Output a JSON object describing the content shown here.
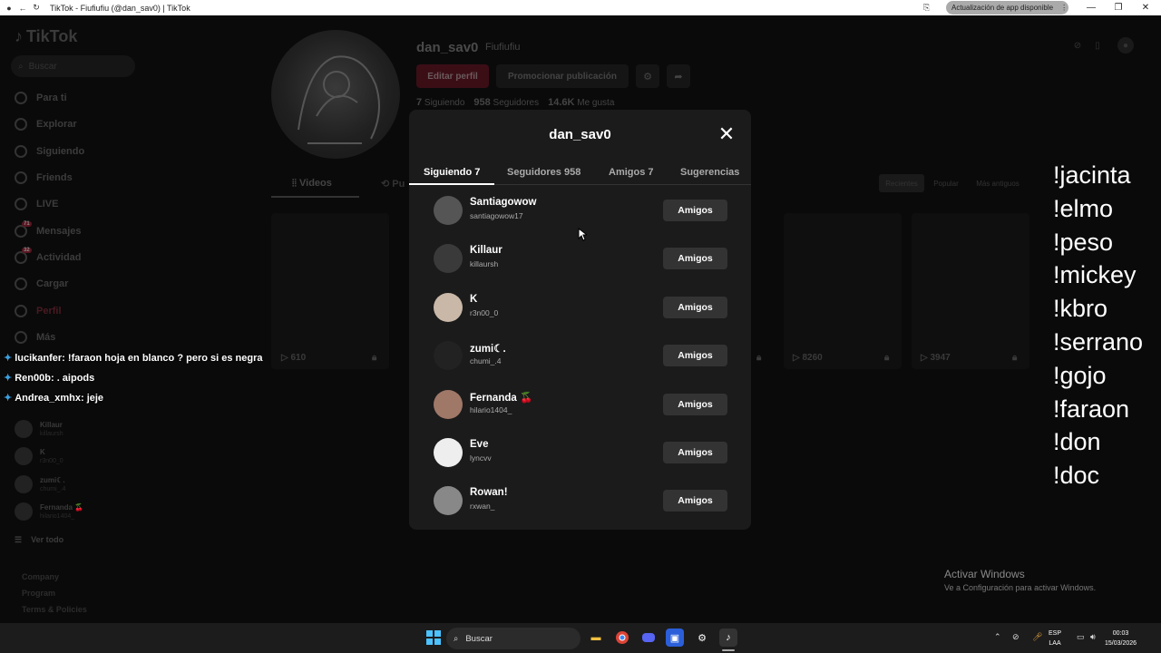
{
  "browser": {
    "title": "TikTok - Fiufiufiu (@dan_sav0) | TikTok",
    "update_pill": "Actualización de app disponible"
  },
  "sidebar": {
    "logo": "TikTok",
    "search_placeholder": "Buscar",
    "nav": [
      {
        "label": "Para ti",
        "icon": "home-icon"
      },
      {
        "label": "Explorar",
        "icon": "compass-icon"
      },
      {
        "label": "Siguiendo",
        "icon": "following-icon"
      },
      {
        "label": "Friends",
        "icon": "friends-icon"
      },
      {
        "label": "LIVE",
        "icon": "live-icon"
      },
      {
        "label": "Mensajes",
        "icon": "messages-icon",
        "badge": "71"
      },
      {
        "label": "Actividad",
        "icon": "activity-icon",
        "badge": "32"
      },
      {
        "label": "Cargar",
        "icon": "upload-icon"
      },
      {
        "label": "Perfil",
        "icon": "profile-icon"
      },
      {
        "label": "Más",
        "icon": "more-icon"
      }
    ],
    "following": [
      {
        "name": "Killaur",
        "user": "killaursh"
      },
      {
        "name": "K",
        "user": "r3n00_0"
      },
      {
        "name": "zumi☾.",
        "user": "chumi_.4"
      },
      {
        "name": "Fernanda 🍒",
        "user": "hilario1404_"
      }
    ],
    "see_all": "Ver todo",
    "footer": [
      "Company",
      "Program",
      "Terms & Policies"
    ]
  },
  "profile": {
    "username": "dan_sav0",
    "nickname": "Fiufiufiu",
    "edit_label": "Editar perfil",
    "promo_label": "Promocionar publicación",
    "following_count": "7",
    "following_label": "Siguiendo",
    "followers_count": "958",
    "followers_label": "Seguidores",
    "likes_count": "14.6K",
    "likes_label": "Me gusta",
    "tab_videos": "Videos",
    "tab_pub": "Pu",
    "sort": [
      "Recientes",
      "Popular",
      "Más antiguos"
    ],
    "video_counts": [
      "610",
      "8260",
      "3947"
    ]
  },
  "modal": {
    "title": "dan_sav0",
    "tabs": [
      "Siguiendo 7",
      "Seguidores 958",
      "Amigos 7",
      "Sugerencias"
    ],
    "rows": [
      {
        "name": "Santiagowow",
        "user": "santiagowow17",
        "btn": "Amigos"
      },
      {
        "name": "Killaur",
        "user": "killaursh",
        "btn": "Amigos"
      },
      {
        "name": "K",
        "user": "r3n00_0",
        "btn": "Amigos"
      },
      {
        "name": "zumi☾.",
        "user": "chumi_.4",
        "btn": "Amigos"
      },
      {
        "name": "Fernanda 🍒",
        "user": "hilario1404_",
        "btn": "Amigos"
      },
      {
        "name": "Eve",
        "user": "lyncvv",
        "btn": "Amigos"
      },
      {
        "name": "Rowan!",
        "user": "rxwan_",
        "btn": "Amigos"
      }
    ]
  },
  "chat": [
    {
      "user": "lucikanfer:",
      "msg": "!faraon hoja en blanco ? pero si es negra"
    },
    {
      "user": "Ren00b:",
      "msg": ". aipods"
    },
    {
      "user": "Andrea_xmhx:",
      "msg": "jeje"
    }
  ],
  "commands": [
    "!jacinta",
    "!elmo",
    "!peso",
    "!mickey",
    "!kbro",
    "!serrano",
    "!gojo",
    "!faraon",
    "!don",
    "!doc"
  ],
  "watermark": {
    "title": "Activar Windows",
    "sub": "Ve a Configuración para activar Windows."
  },
  "taskbar": {
    "search": "Buscar",
    "lang_top": "ESP",
    "lang_bottom": "LAA",
    "time": "00:03",
    "date": "15/03/2026"
  },
  "colors": {
    "modal_bg": "#1b1b1b",
    "button_bg": "#333333",
    "chat_star": "#3aa0e0"
  }
}
